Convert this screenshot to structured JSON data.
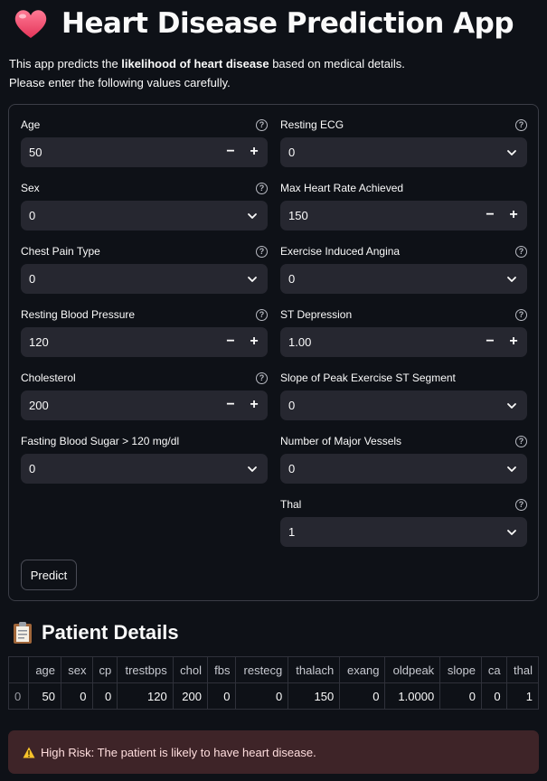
{
  "header": {
    "title": "Heart Disease Prediction App",
    "intro_prefix": "This app predicts the ",
    "intro_bold": "likelihood of heart disease",
    "intro_suffix": " based on medical details.",
    "intro_line2": "Please enter the following values carefully."
  },
  "form": {
    "age": {
      "label": "Age",
      "value": "50"
    },
    "sex": {
      "label": "Sex",
      "value": "0"
    },
    "chest_pain": {
      "label": "Chest Pain Type",
      "value": "0"
    },
    "resting_bp": {
      "label": "Resting Blood Pressure",
      "value": "120"
    },
    "cholesterol": {
      "label": "Cholesterol",
      "value": "200"
    },
    "fbs": {
      "label": "Fasting Blood Sugar > 120 mg/dl",
      "value": "0"
    },
    "resting_ecg": {
      "label": "Resting ECG",
      "value": "0"
    },
    "max_hr": {
      "label": "Max Heart Rate Achieved",
      "value": "150"
    },
    "exercise_angina": {
      "label": "Exercise Induced Angina",
      "value": "0"
    },
    "st_depression": {
      "label": "ST Depression",
      "value": "1.00"
    },
    "slope": {
      "label": "Slope of Peak Exercise ST Segment",
      "value": "0"
    },
    "major_vessels": {
      "label": "Number of Major Vessels",
      "value": "0"
    },
    "thal": {
      "label": "Thal",
      "value": "1"
    },
    "help_glyph": "?",
    "minus_glyph": "−",
    "plus_glyph": "+",
    "predict_label": "Predict"
  },
  "details": {
    "title": "Patient Details",
    "index_header": "",
    "columns": [
      "age",
      "sex",
      "cp",
      "trestbps",
      "chol",
      "fbs",
      "restecg",
      "thalach",
      "exang",
      "oldpeak",
      "slope",
      "ca",
      "thal"
    ],
    "row_index": "0",
    "row": [
      "50",
      "0",
      "0",
      "120",
      "200",
      "0",
      "0",
      "150",
      "0",
      "1.0000",
      "0",
      "0",
      "1"
    ]
  },
  "alert": {
    "text": "High Risk: The patient is likely to have heart disease."
  },
  "colors": {
    "background": "#0e1117",
    "input": "#262730",
    "alert_bg": "#3e2428",
    "heart": "#f0506e"
  }
}
